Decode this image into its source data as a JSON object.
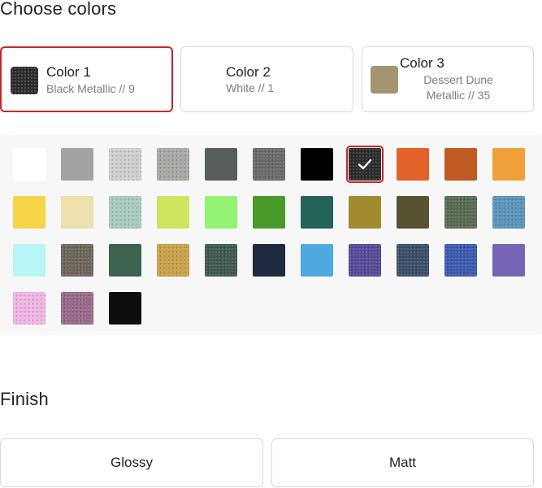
{
  "choose_colors": {
    "title": "Choose colors",
    "slots": [
      {
        "name": "Color 1",
        "sub": "Black Metallic // 9",
        "swatch": "#2c2c2c",
        "active": true
      },
      {
        "name": "Color 2",
        "sub": "White // 1",
        "swatch": "#ffffff",
        "active": false
      },
      {
        "name": "Color 3",
        "sub": "Dessert Dune Metallic // 35",
        "swatch": "#a39572",
        "active": false
      }
    ]
  },
  "palette": {
    "selected_index": 7,
    "swatches": [
      {
        "color": "#ffffff",
        "textured": false
      },
      {
        "color": "#a2a3a5",
        "textured": false
      },
      {
        "color": "#cfcfcd",
        "textured": true
      },
      {
        "color": "#a9a8a4",
        "textured": true
      },
      {
        "color": "#575d5b",
        "textured": false
      },
      {
        "color": "#6a6a6a",
        "textured": true
      },
      {
        "color": "#000000",
        "textured": false
      },
      {
        "color": "#2c2c2c",
        "textured": true
      },
      {
        "color": "#e1622a",
        "textured": false
      },
      {
        "color": "#c05a22",
        "textured": false
      },
      {
        "color": "#f0a03a",
        "textured": false
      },
      {
        "color": "#f7d446",
        "textured": false
      },
      {
        "color": "#ede0ac",
        "textured": false
      },
      {
        "color": "#a9ccbd",
        "textured": true
      },
      {
        "color": "#cde65d",
        "textured": false
      },
      {
        "color": "#92f472",
        "textured": false
      },
      {
        "color": "#489a2a",
        "textured": false
      },
      {
        "color": "#236458",
        "textured": false
      },
      {
        "color": "#a28a30",
        "textured": false
      },
      {
        "color": "#575231",
        "textured": false
      },
      {
        "color": "#5a6a50",
        "textured": true
      },
      {
        "color": "#5a95ba",
        "textured": true
      },
      {
        "color": "#b6f6f6",
        "textured": false
      },
      {
        "color": "#6c665d",
        "textured": true
      },
      {
        "color": "#3d6350",
        "textured": false
      },
      {
        "color": "#caa34a",
        "textured": true
      },
      {
        "color": "#3e5a4e",
        "textured": true
      },
      {
        "color": "#1e2a3e",
        "textured": false
      },
      {
        "color": "#4fa8e0",
        "textured": false
      },
      {
        "color": "#574a9a",
        "textured": true
      },
      {
        "color": "#3a5068",
        "textured": true
      },
      {
        "color": "#3a5ab0",
        "textured": true
      },
      {
        "color": "#7565b4",
        "textured": false
      },
      {
        "color": "#f0b6e4",
        "textured": true
      },
      {
        "color": "#9a6a8a",
        "textured": true
      },
      {
        "color": "#0e0e0e",
        "textured": false
      }
    ]
  },
  "finish": {
    "title": "Finish",
    "options": [
      "Glossy",
      "Matt"
    ]
  },
  "colors": {
    "accent": "#c8262c",
    "border": "#d9d9d9",
    "palette_bg": "#f7f7f7"
  },
  "icons": {
    "selected": "check-icon"
  }
}
